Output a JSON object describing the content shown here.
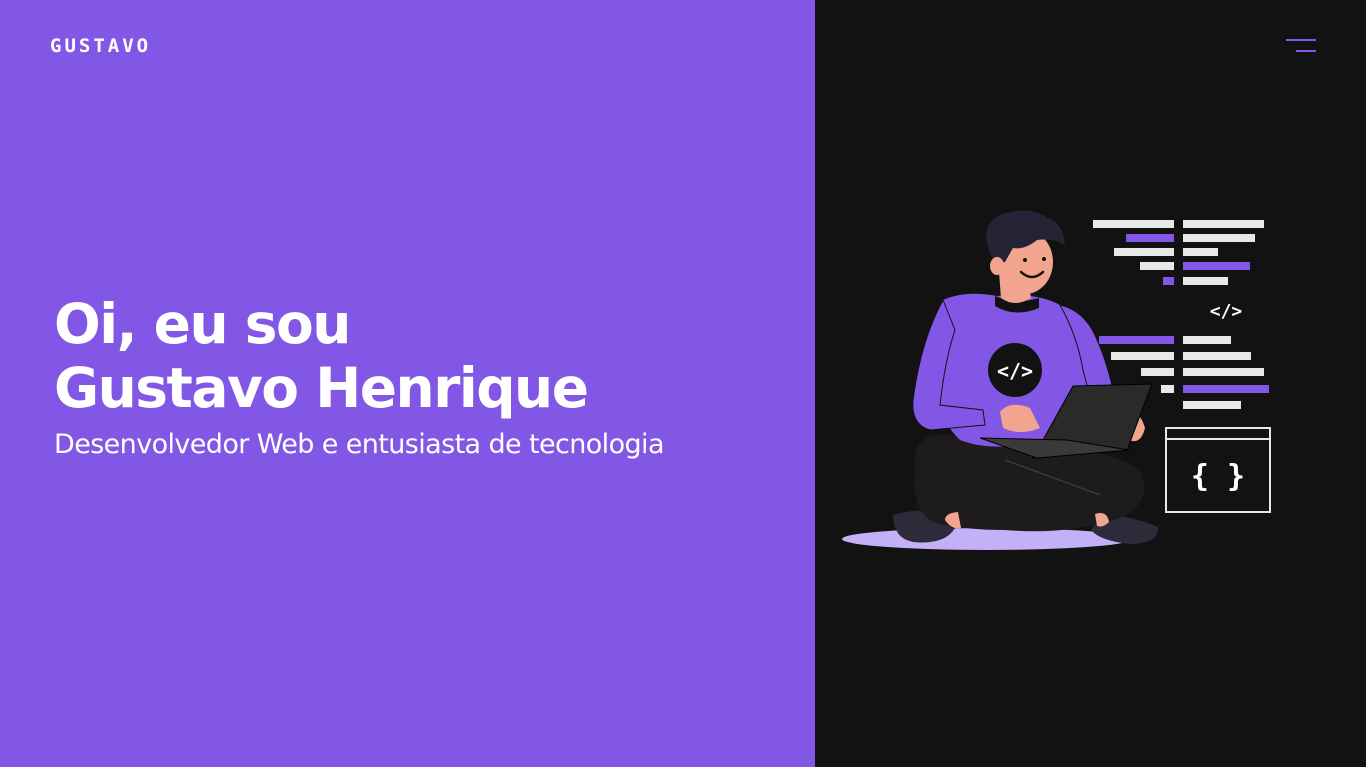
{
  "header": {
    "logo": "GUSTAVO"
  },
  "hero": {
    "line1": "Oi, eu sou",
    "line2": "Gustavo Henrique",
    "subtitle": "Desenvolvedor Web e entusiasta de tecnologia"
  },
  "illustration": {
    "name": "developer-with-laptop",
    "shirt_icon": "</>",
    "tag_icon": "</>",
    "braces_icon": "{ }"
  },
  "colors": {
    "accent": "#8257e5",
    "dark": "#121212",
    "light_purple": "#c4b0f7"
  }
}
